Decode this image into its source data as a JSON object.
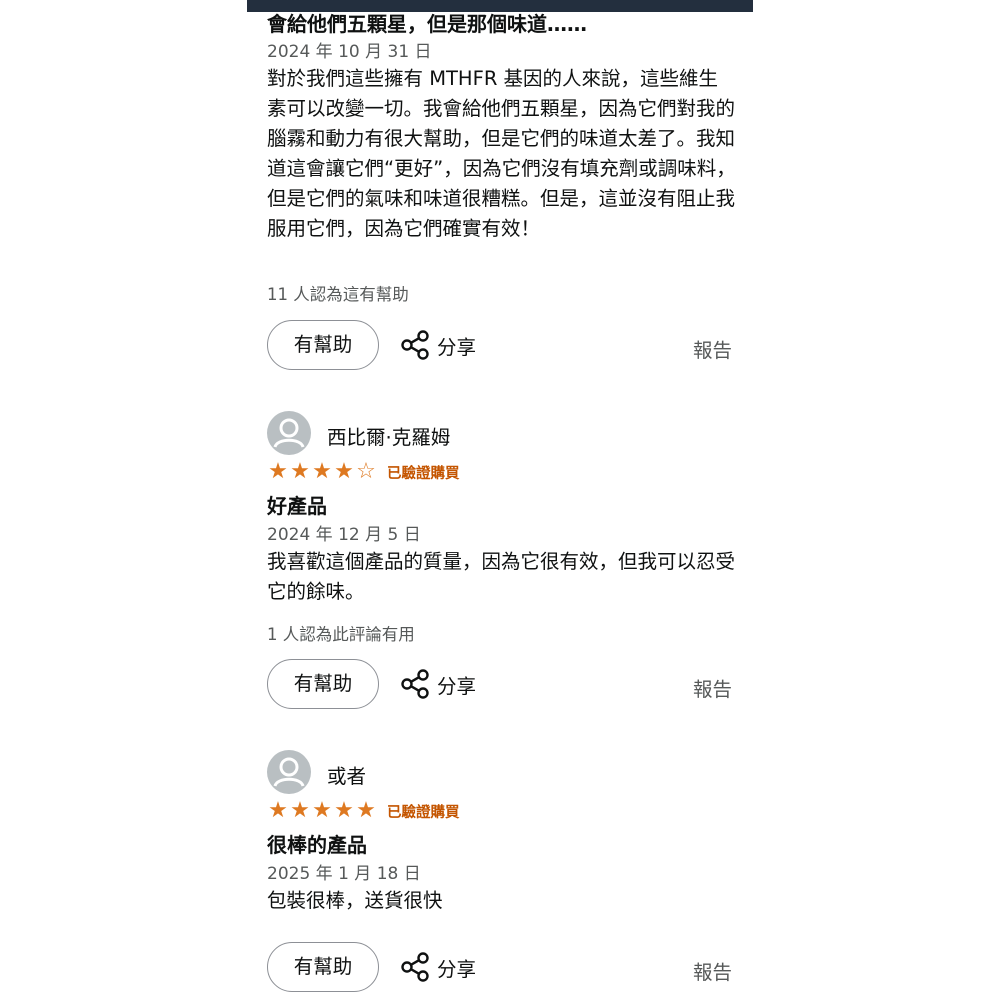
{
  "reviews": [
    {
      "headline": "會給他們五顆星，但是那個味道……",
      "date": "2024 年 10 月 31 日",
      "body": "對於我們這些擁有 MTHFR 基因的人來說，這些維生素可以改變一切。我會給他們五顆星，因為它們對我的腦霧和動力有很大幫助，但是它們的味道太差了。我知道這會讓它們“更好”，因為它們沒有填充劑或調味料，但是它們的氣味和味道很糟糕。但是，這並沒有阻止我服用它們，因為它們確實有效！",
      "helpful_count": "11 人認為這有幫助",
      "helpful_button": "有幫助",
      "share_label": "分享",
      "report_label": "報告"
    },
    {
      "reviewer": "西比爾·克羅姆",
      "rating": 4,
      "verified": "已驗證購買",
      "headline": "好產品",
      "date": "2024 年 12 月 5 日",
      "body": "我喜歡這個產品的質量，因為它很有效，但我可以忍受它的餘味。",
      "helpful_count": "1 人認為此評論有用",
      "helpful_button": "有幫助",
      "share_label": "分享",
      "report_label": "報告"
    },
    {
      "reviewer": "或者",
      "rating": 5,
      "verified": "已驗證購買",
      "headline": "很棒的產品",
      "date": "2025 年 1 月 18 日",
      "body": "包裝很棒，送貨很快",
      "helpful_button": "有幫助",
      "share_label": "分享",
      "report_label": "報告"
    }
  ],
  "colors": {
    "star": "#de7921",
    "verified": "#c45500",
    "topbar": "#232f3e"
  }
}
